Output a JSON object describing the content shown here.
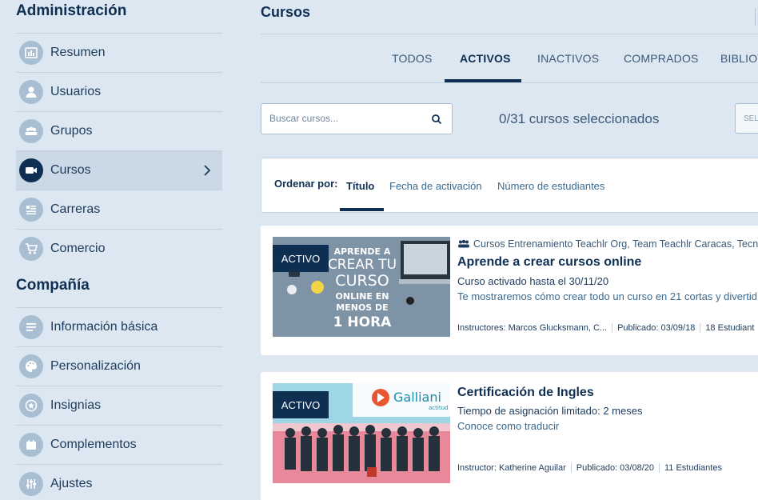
{
  "sidebar": {
    "admin_title": "Administración",
    "admin_items": [
      {
        "label": "Resumen",
        "icon": "bar-chart-icon"
      },
      {
        "label": "Usuarios",
        "icon": "user-icon"
      },
      {
        "label": "Grupos",
        "icon": "group-icon"
      },
      {
        "label": "Cursos",
        "icon": "video-camera-icon"
      },
      {
        "label": "Carreras",
        "icon": "list-icon"
      },
      {
        "label": "Comercio",
        "icon": "cart-icon"
      }
    ],
    "company_title": "Compañía",
    "company_items": [
      {
        "label": "Información básica",
        "icon": "lines-icon"
      },
      {
        "label": "Personalización",
        "icon": "palette-icon"
      },
      {
        "label": "Insignias",
        "icon": "star-icon"
      },
      {
        "label": "Complementos",
        "icon": "calendar-icon"
      },
      {
        "label": "Ajustes",
        "icon": "sliders-icon"
      }
    ]
  },
  "main": {
    "title": "Cursos",
    "tabs": [
      "TODOS",
      "ACTIVOS",
      "INACTIVOS",
      "COMPRADOS",
      "BIBLIOT"
    ],
    "search_placeholder": "Buscar cursos...",
    "selected_count": "0/31 cursos seleccionados",
    "select_button": "SEL",
    "sort": {
      "label": "Ordenar por:",
      "options": [
        "Título",
        "Fecha de activación",
        "Número de estudiantes"
      ]
    },
    "courses": [
      {
        "badge": "ACTIVO",
        "orgs": "Cursos Entrenamiento Teachlr Org, Team Teachlr Caracas, Tecn",
        "title": "Aprende a crear cursos online",
        "subtitle": "Curso activado hasta el 30/11/20",
        "description": "Te mostraremos cómo crear todo un curso en 21 cortas y divertid",
        "instructors": "Instructores: Marcos Glucksmann, C...",
        "published": "Publicado: 03/09/18",
        "students": "18 Estudiant",
        "thumb_lines": [
          "APRENDE A",
          "CREAR TU",
          "CURSO",
          "ONLINE EN",
          "MENOS DE",
          "1 HORA"
        ]
      },
      {
        "badge": "ACTIVO",
        "title": "Certificación de Ingles",
        "subtitle": "Tiempo de asignación limitado: 2 meses",
        "description": "Conoce como traducir",
        "instructors": "Instructor: Katherine Aguilar",
        "published": "Publicado: 03/08/20",
        "students": "11 Estudiantes",
        "logo_text": "Galliani",
        "logo_sub": "actitud"
      }
    ]
  },
  "colors": {
    "navy": "#0f2f52",
    "background": "#dce7f1",
    "link": "#3b6a8f"
  }
}
